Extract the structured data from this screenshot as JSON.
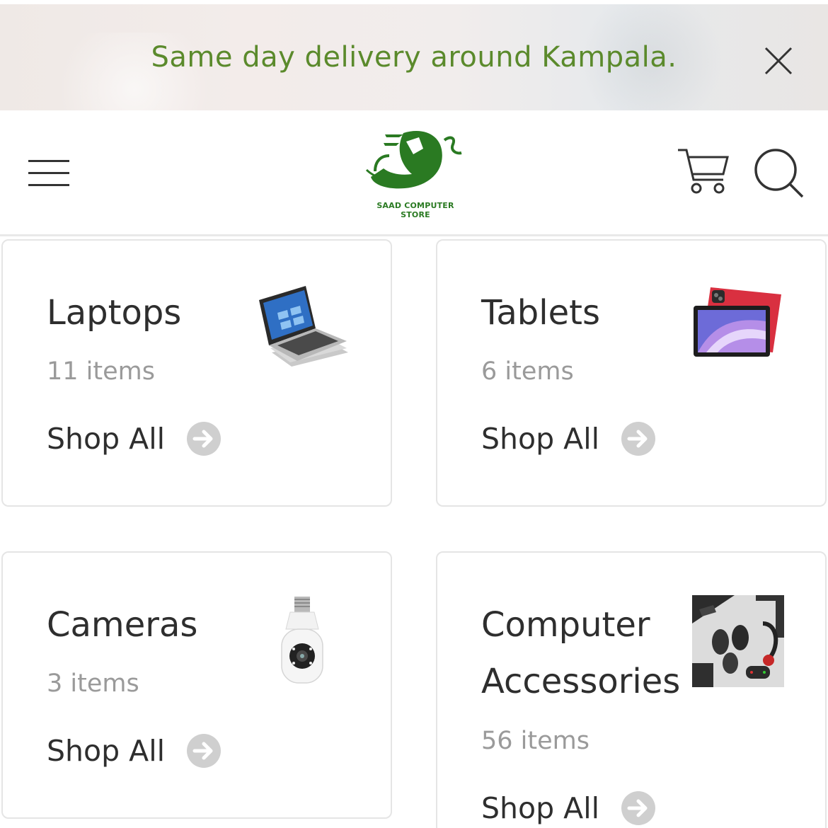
{
  "announcement": {
    "text": "Same day delivery around Kampala."
  },
  "header": {
    "logo_text": "SAAD COMPUTER STORE",
    "icons": [
      "menu-icon",
      "cart-icon",
      "search-icon",
      "close-icon"
    ]
  },
  "categories": [
    {
      "title": "Laptops",
      "count": "11 items",
      "link_label": "Shop All",
      "image": "laptop"
    },
    {
      "title": "Tablets",
      "count": "6 items",
      "link_label": "Shop All",
      "image": "tablet"
    },
    {
      "title": "Cameras",
      "count": "3 items",
      "link_label": "Shop All",
      "image": "camera-bulb"
    },
    {
      "title_line1": "Computer",
      "title_line2": "Accessories",
      "count": "56 items",
      "link_label": "Shop All",
      "image": "accessories"
    }
  ],
  "colors": {
    "announcement_text": "#5b8a2c",
    "brand_green": "#2a7a22",
    "card_border": "#e5e5e5",
    "arrow_circle": "#cfcfcf"
  }
}
